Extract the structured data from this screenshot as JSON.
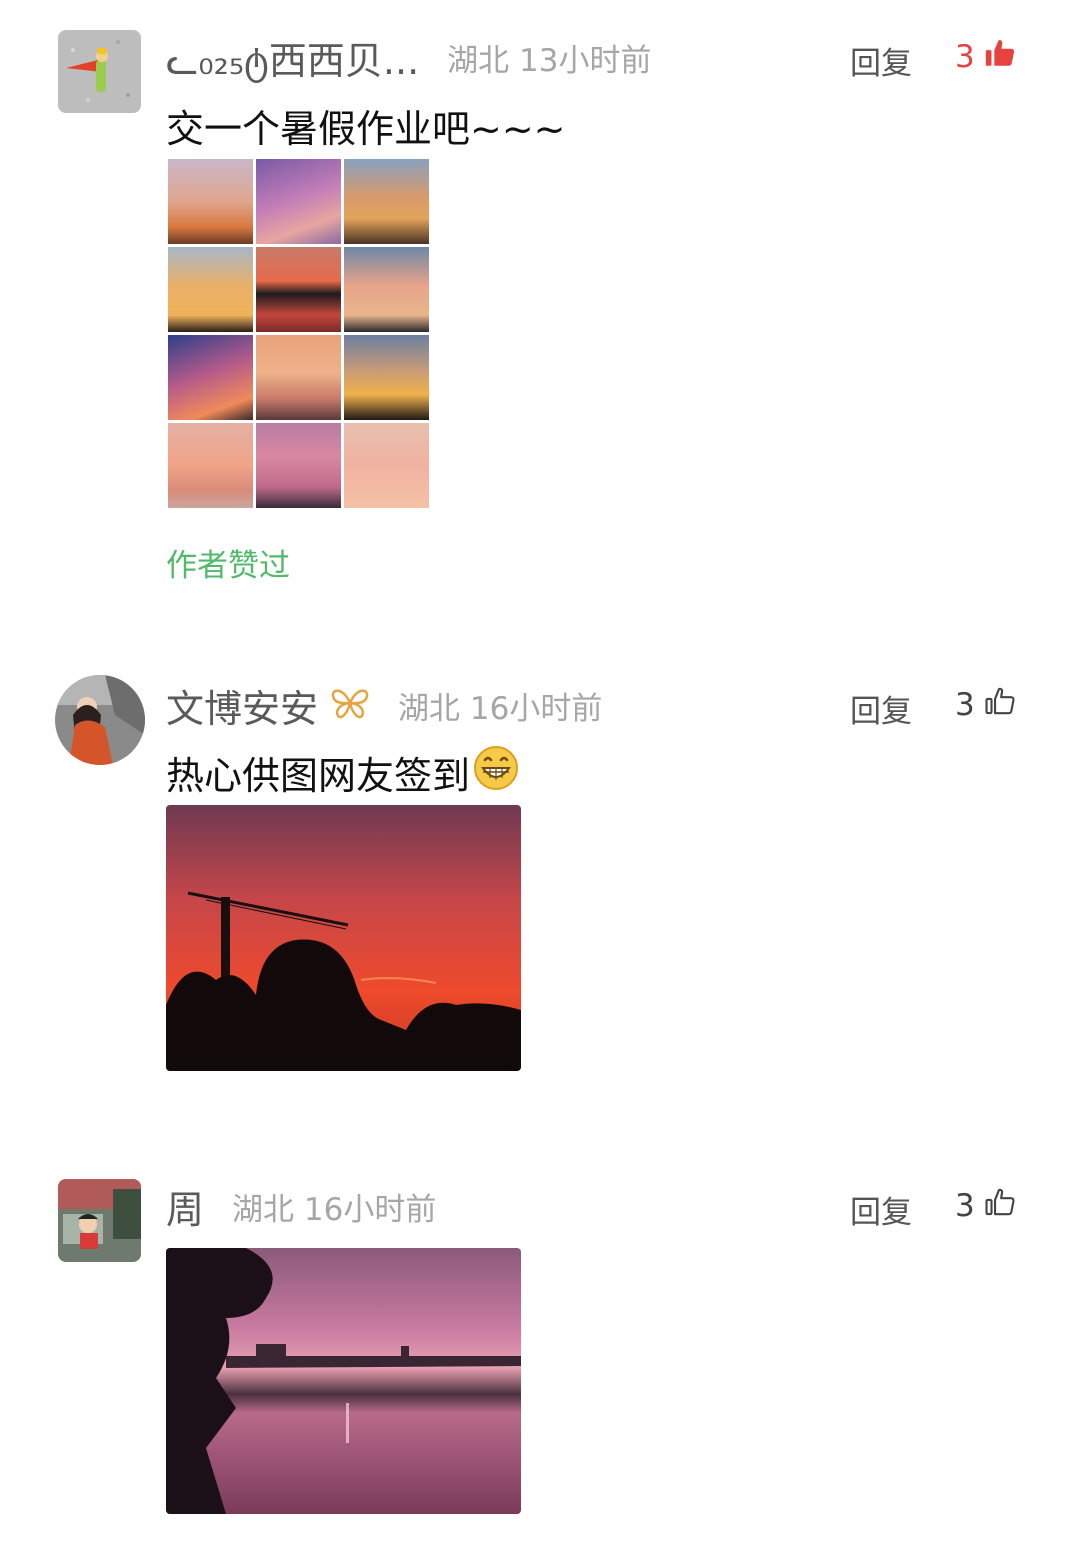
{
  "comments": [
    {
      "name": "ᓚ₀₂₅ტ西西贝...",
      "location": "湖北",
      "time": "13小时前",
      "reply_label": "回复",
      "likes": "3",
      "liked": true,
      "text": "交一个暑假作业吧~~~",
      "author_liked_label": "作者赞过",
      "image_grid_count": 12
    },
    {
      "name": "文博安安",
      "location": "湖北",
      "time": "16小时前",
      "reply_label": "回复",
      "likes": "3",
      "liked": false,
      "text": "热心供图网友签到"
    },
    {
      "name": "周",
      "location": "湖北",
      "time": "16小时前",
      "reply_label": "回复",
      "likes": "3",
      "liked": false
    }
  ],
  "colors": {
    "like_active": "#e64340",
    "author_liked": "#52b96b",
    "meta": "#a6a6a6"
  },
  "icons": {
    "like": "thumbs-up-icon",
    "badge": "butterfly-badge-icon",
    "emoji": "grinning-emoji-icon"
  }
}
